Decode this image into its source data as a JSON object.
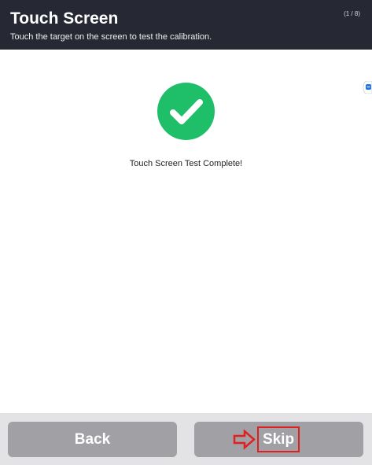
{
  "header": {
    "title": "Touch Screen",
    "subtitle": "Touch the target on the screen to test the calibration.",
    "step": "(1 / 8)"
  },
  "main": {
    "status_icon": "checkmark-circle-icon",
    "status_color": "#1fbf6a",
    "message": "Touch Screen Test Complete!"
  },
  "footer": {
    "back_label": "Back",
    "skip_label": "Skip",
    "highlight_color": "#e02020"
  }
}
